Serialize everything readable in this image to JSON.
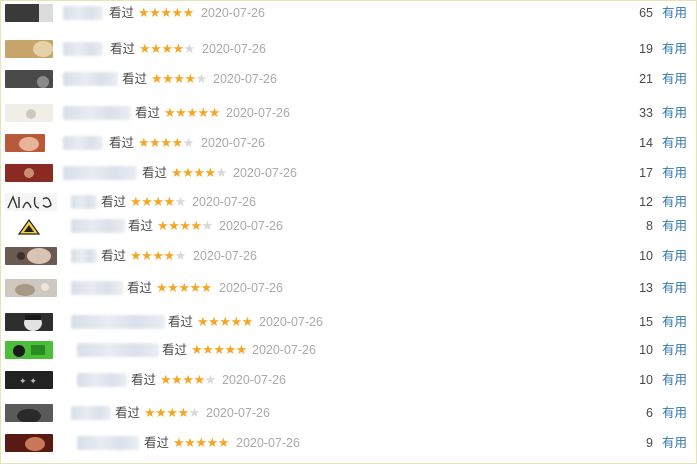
{
  "reviews": [
    {
      "status": "看过",
      "stars": 5,
      "date": "2020-07-26",
      "votes": "65",
      "useful_label": "有用",
      "avatar_color": "#3a3a3a"
    },
    {
      "status": "看过",
      "stars": 4,
      "date": "2020-07-26",
      "votes": "19",
      "useful_label": "有用",
      "avatar_color": "#c9a46a"
    },
    {
      "status": "看过",
      "stars": 4,
      "date": "2020-07-26",
      "votes": "21",
      "useful_label": "有用",
      "avatar_color": "#4a4a4a"
    },
    {
      "status": "看过",
      "stars": 5,
      "date": "2020-07-26",
      "votes": "33",
      "useful_label": "有用",
      "avatar_color": "#e8e4dc"
    },
    {
      "status": "看过",
      "stars": 4,
      "date": "2020-07-26",
      "votes": "14",
      "useful_label": "有用",
      "avatar_color": "#b85a3a"
    },
    {
      "status": "看过",
      "stars": 4,
      "date": "2020-07-26",
      "votes": "17",
      "useful_label": "有用",
      "avatar_color": "#8a2a22"
    },
    {
      "status": "看过",
      "stars": 4,
      "date": "2020-07-26",
      "votes": "12",
      "useful_label": "有用",
      "avatar_color": "#f2f2f2"
    },
    {
      "status": "看过",
      "stars": 4,
      "date": "2020-07-26",
      "votes": "8",
      "useful_label": "有用",
      "avatar_color": "#f4d23c"
    },
    {
      "status": "看过",
      "stars": 4,
      "date": "2020-07-26",
      "votes": "10",
      "useful_label": "有用",
      "avatar_color": "#6a5a50"
    },
    {
      "status": "看过",
      "stars": 5,
      "date": "2020-07-26",
      "votes": "13",
      "useful_label": "有用",
      "avatar_color": "#cfc8c0"
    },
    {
      "status": "看过",
      "stars": 5,
      "date": "2020-07-26",
      "votes": "15",
      "useful_label": "有用",
      "avatar_color": "#2e2e2e"
    },
    {
      "status": "看过",
      "stars": 5,
      "date": "2020-07-26",
      "votes": "10",
      "useful_label": "有用",
      "avatar_color": "#4bbf3a"
    },
    {
      "status": "看过",
      "stars": 4,
      "date": "2020-07-26",
      "votes": "10",
      "useful_label": "有用",
      "avatar_color": "#222222"
    },
    {
      "status": "看过",
      "stars": 4,
      "date": "2020-07-26",
      "votes": "6",
      "useful_label": "有用",
      "avatar_color": "#5a5a5a"
    },
    {
      "status": "看过",
      "stars": 5,
      "date": "2020-07-26",
      "votes": "9",
      "useful_label": "有用",
      "avatar_color": "#5a1a14"
    }
  ],
  "colors": {
    "star_on": "#f6a623",
    "star_off": "#d9d9d9",
    "link": "#3377aa",
    "date": "#aaaaaa"
  }
}
